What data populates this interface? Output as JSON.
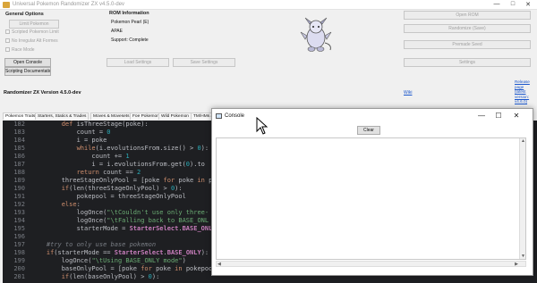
{
  "window": {
    "title": "Universal Pokemon Randomizer ZX v4.5.0-dev",
    "min": "—",
    "max": "□",
    "close": "✕"
  },
  "general_options": {
    "title": "General Options",
    "limit_pokemon": "Limit Pokemon",
    "scripted_limit": "Scripted Pokemon Limit",
    "no_irregular": "No Irregular Alt Formes",
    "race_mode": "Race Mode",
    "open_console": "Open Console",
    "scripting_docs": "Scripting Documentation"
  },
  "rom_info": {
    "title": "ROM Information",
    "name": "Pokemon Pearl (E)",
    "code": "APAE",
    "support": "Support: Complete"
  },
  "buttons": {
    "load_settings": "Load Settings",
    "save_settings": "Save Settings",
    "open_rom": "Open ROM",
    "randomize": "Randomize (Save)",
    "premade_seed": "Premade Seed",
    "settings": "Settings"
  },
  "version_label": "Randomizer ZX Version 4.5.0-dev",
  "wiki": "Wiki",
  "release_link": [
    "Release",
    "page",
    "(latest",
    "version:",
    "v4.6.0)"
  ],
  "tabs": [
    "Pokemon Traits",
    "Starters, Statics & Trades",
    "Moves & Movesets",
    "Foe Pokemon",
    "Wild Pokemon",
    "TM/HMs &"
  ],
  "code": [
    {
      "n": "182",
      "t": "        def isThreeStage(poke):"
    },
    {
      "n": "183",
      "t": "            count = 0"
    },
    {
      "n": "184",
      "t": "            i = poke"
    },
    {
      "n": "185",
      "t": "            while(i.evolutionsFrom.size() > 0):"
    },
    {
      "n": "186",
      "t": "                count += 1"
    },
    {
      "n": "187",
      "t": "                i = i.evolutionsFrom.get(0).to"
    },
    {
      "n": "188",
      "t": "            return count == 2"
    },
    {
      "n": "189",
      "t": "        threeStageOnlyPool = [poke for poke in p"
    },
    {
      "n": "190",
      "t": "        if(len(threeStageOnlyPool) > 0):"
    },
    {
      "n": "191",
      "t": "            pokepool = threeStageOnlyPool"
    },
    {
      "n": "192",
      "t": "        else:"
    },
    {
      "n": "193",
      "t": "            logOnce(\"\\tCouldn't use only three-"
    },
    {
      "n": "194",
      "t": "            logOnce(\"\\tFalling back to BASE_ONL"
    },
    {
      "n": "195",
      "t": "            starterMode = StarterSelect.BASE_ONL"
    },
    {
      "n": "196",
      "t": ""
    },
    {
      "n": "197",
      "t": "    #try to only use base pokemon"
    },
    {
      "n": "198",
      "t": "    if(starterMode == StarterSelect.BASE_ONLY):"
    },
    {
      "n": "199",
      "t": "        logOnce(\"\\tUsing BASE_ONLY mode\")"
    },
    {
      "n": "200",
      "t": "        baseOnlyPool = [poke for poke in pokepool if poke.evolutionsTo.size() == 0]"
    },
    {
      "n": "201",
      "t": "        if(len(baseOnlyPool) > 0):"
    }
  ],
  "console": {
    "title": "Console",
    "clear": "Clear",
    "min": "—",
    "max": "☐",
    "close": "✕"
  }
}
